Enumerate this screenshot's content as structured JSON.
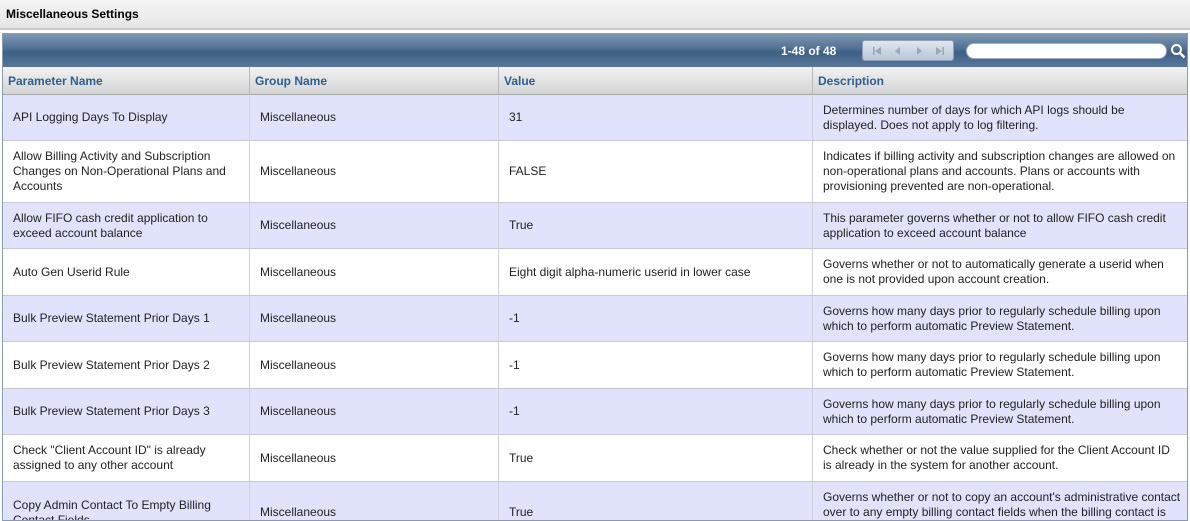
{
  "page": {
    "title": "Miscellaneous Settings"
  },
  "toolbar": {
    "record_count": "1-48 of 48",
    "search_placeholder": ""
  },
  "columns": [
    "Parameter Name",
    "Group Name",
    "Value",
    "Description"
  ],
  "rows": [
    {
      "name": "API Logging Days To Display",
      "group": "Miscellaneous",
      "value": "31",
      "description": "Determines number of days for which API logs should be displayed. Does not apply to log filtering."
    },
    {
      "name": "Allow Billing Activity and Subscription Changes on Non-Operational Plans and Accounts",
      "group": "Miscellaneous",
      "value": "FALSE",
      "description": "Indicates if billing activity and subscription changes are allowed on non-operational plans and accounts. Plans or accounts with provisioning prevented are non-operational."
    },
    {
      "name": "Allow FIFO cash credit application to exceed account balance",
      "group": "Miscellaneous",
      "value": "True",
      "description": "This parameter governs whether or not to allow FIFO cash credit application to exceed account balance"
    },
    {
      "name": "Auto Gen Userid Rule",
      "group": "Miscellaneous",
      "value": "Eight digit alpha-numeric userid in lower case",
      "description": "Governs whether or not to automatically generate a userid when one is not provided upon account creation."
    },
    {
      "name": "Bulk Preview Statement Prior Days 1",
      "group": "Miscellaneous",
      "value": "-1",
      "description": "Governs how many days prior to regularly schedule billing upon which to perform automatic Preview Statement."
    },
    {
      "name": "Bulk Preview Statement Prior Days 2",
      "group": "Miscellaneous",
      "value": "-1",
      "description": "Governs how many days prior to regularly schedule billing upon which to perform automatic Preview Statement."
    },
    {
      "name": "Bulk Preview Statement Prior Days 3",
      "group": "Miscellaneous",
      "value": "-1",
      "description": "Governs how many days prior to regularly schedule billing upon which to perform automatic Preview Statement."
    },
    {
      "name": "Check \"Client Account ID\" is already assigned to any other account",
      "group": "Miscellaneous",
      "value": "True",
      "description": "Check whether or not the value supplied for the Client Account ID is already in the system for another account."
    },
    {
      "name": "Copy Admin Contact To Empty Billing Contact Fields",
      "group": "Miscellaneous",
      "value": "True",
      "description": "Governs whether or not to copy an account's administrative contact over to any empty billing contact fields when the billing contact is created."
    }
  ]
}
